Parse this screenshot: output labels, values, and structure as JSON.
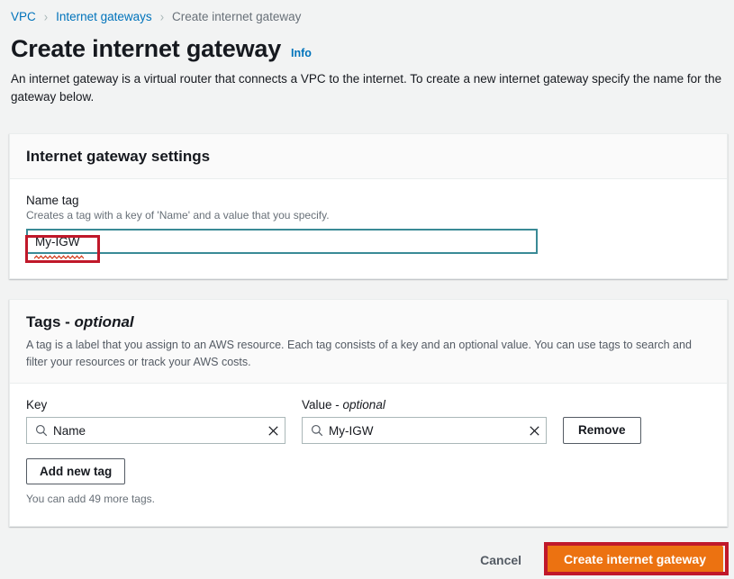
{
  "breadcrumb": {
    "items": [
      {
        "label": "VPC",
        "current": false
      },
      {
        "label": "Internet gateways",
        "current": false
      },
      {
        "label": "Create internet gateway",
        "current": true
      }
    ],
    "separator": "›"
  },
  "header": {
    "title": "Create internet gateway",
    "info_label": "Info",
    "description": "An internet gateway is a virtual router that connects a VPC to the internet. To create a new internet gateway specify the name for the gateway below."
  },
  "settings_card": {
    "title": "Internet gateway settings",
    "name_tag": {
      "label": "Name tag",
      "hint": "Creates a tag with a key of 'Name' and a value that you specify.",
      "value": "My-IGW",
      "placeholder": ""
    }
  },
  "tags_card": {
    "title_main": "Tags",
    "title_dash": " - ",
    "title_optional": "optional",
    "description": "A tag is a label that you assign to an AWS resource. Each tag consists of a key and an optional value. You can use tags to search and filter your resources or track your AWS costs.",
    "columns": {
      "key_label": "Key",
      "value_label_main": "Value",
      "value_label_dash": " - ",
      "value_label_optional": "optional"
    },
    "rows": [
      {
        "key": "Name",
        "key_placeholder": "Name",
        "value": "My-IGW",
        "value_placeholder": "",
        "remove_label": "Remove"
      }
    ],
    "add_tag_label": "Add new tag",
    "helper_text": "You can add 49 more tags."
  },
  "footer": {
    "cancel_label": "Cancel",
    "submit_label": "Create internet gateway"
  },
  "icons": {
    "search": "search-icon",
    "clear": "close-icon",
    "chevron": "chevron-right-icon"
  },
  "colors": {
    "link_blue": "#0073bb",
    "primary_orange": "#ec7211",
    "annotation_red": "#c0182a",
    "focus_teal": "#3a8a96",
    "page_bg": "#f2f3f3"
  }
}
